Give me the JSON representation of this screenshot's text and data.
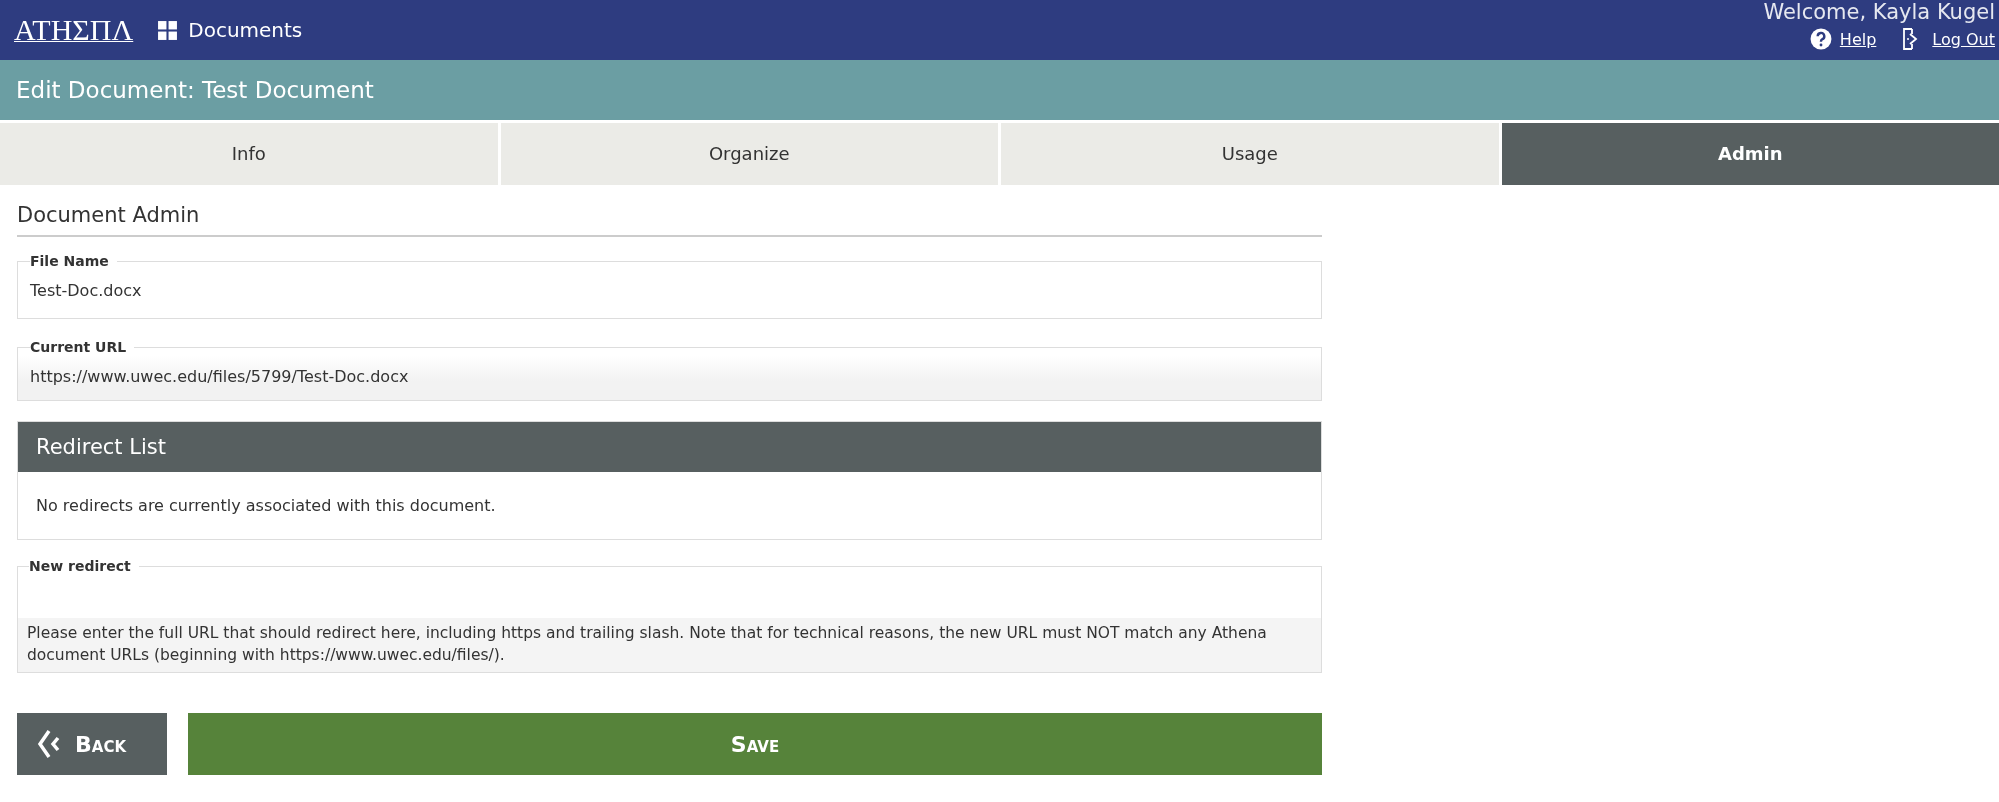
{
  "header": {
    "logo": "ΑΤΗΣΠΛ",
    "app": "Documents",
    "welcome": "Welcome, Kayla Kugel",
    "links": [
      {
        "kind": "help",
        "label": "Help"
      },
      {
        "kind": "logout",
        "label": "Log Out"
      }
    ]
  },
  "page_title": "Edit Document: Test Document",
  "tabs": [
    {
      "label": "Info",
      "selected": false
    },
    {
      "label": "Organize",
      "selected": false
    },
    {
      "label": "Usage",
      "selected": false
    },
    {
      "label": "Admin",
      "selected": true
    }
  ],
  "section_title": "Document Admin",
  "fields": [
    {
      "label": "File Name",
      "value": "Test-Doc.docx",
      "disabled": false
    },
    {
      "label": "Current URL",
      "value": "https://www.uwec.edu/files/5799/Test-Doc.docx",
      "disabled": true
    }
  ],
  "redirect_list": {
    "title": "Redirect List",
    "empty_text": "No redirects are currently associated with this document."
  },
  "new_redirect": {
    "label": "New redirect",
    "help": "Please enter the full URL that should redirect here, including https and trailing slash. Note that for technical reasons, the new URL must NOT match any Athena document URLs (beginning with https://www.uwec.edu/files/)."
  },
  "buttons": [
    {
      "kind": "back",
      "label": "Back"
    },
    {
      "kind": "save",
      "label": "Save"
    }
  ]
}
